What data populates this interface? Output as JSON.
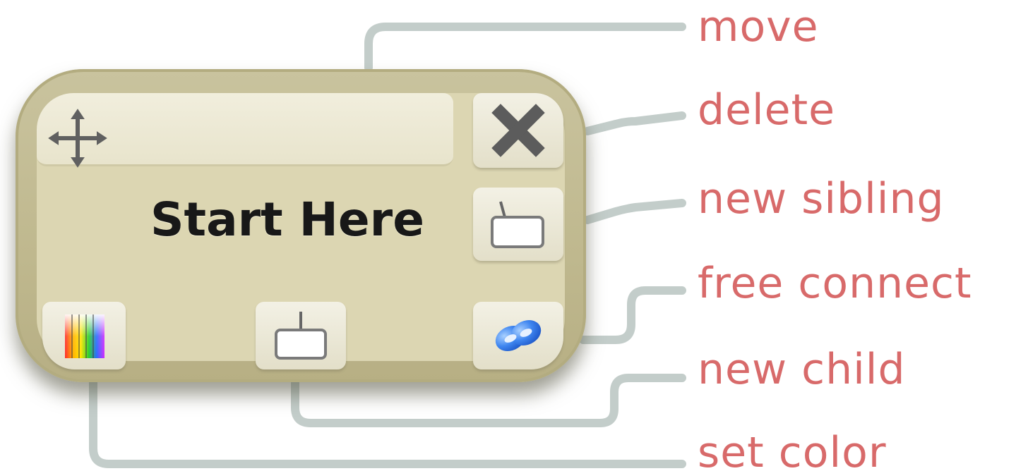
{
  "node": {
    "title": "Start Here"
  },
  "callouts": {
    "move": "move",
    "delete": "delete",
    "new_sibling": "new sibling",
    "free_connect": "free connect",
    "new_child": "new child",
    "set_color": "set color"
  },
  "icons": {
    "move": "move-arrows-icon",
    "delete": "close-x-icon",
    "new_sibling": "new-sibling-icon",
    "free_connect": "link-icon",
    "new_child": "new-child-icon",
    "set_color": "color-palette-icon"
  },
  "colors": {
    "callout_text": "#d86a6a",
    "connector": "#c3cdca",
    "node_border": "#bfb88e",
    "node_fill": "#dcd6b2",
    "title_text": "#181818"
  }
}
